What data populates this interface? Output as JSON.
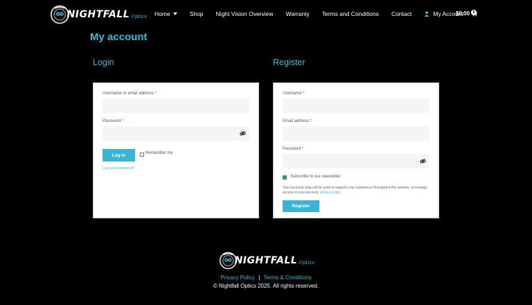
{
  "brand": {
    "name": "NIGHTFALL",
    "sub": "Optics",
    "accent": "#39b9d6"
  },
  "nav": {
    "items": [
      "Home",
      "Shop",
      "Night Vision Overview",
      "Warranty",
      "Terms and Conditions",
      "Contact"
    ],
    "account": "My Account",
    "cart_total": "$0.00",
    "cart_count": "0"
  },
  "page_title": "My account",
  "login": {
    "title": "Login",
    "username_label": "Username or email address",
    "password_label": "Password",
    "required_mark": "*",
    "submit": "Log in",
    "remember": "Remember me",
    "lost_password": "Lost your password?"
  },
  "register": {
    "title": "Register",
    "username_label": "Username",
    "email_label": "Email address",
    "password_label": "Password",
    "required_mark": "*",
    "newsletter": "Subscribe to our newsletter",
    "privacy_text": "Your personal data will be used to support your experience throughout this website, to manage access to your account,",
    "privacy_link": "privacy policy",
    "submit": "Register"
  },
  "footer": {
    "privacy": "Privacy Policy",
    "separator": "|",
    "terms": "Terms & Conditions",
    "copyright": "© Nightfall Optics 2025. All rights reserved."
  }
}
